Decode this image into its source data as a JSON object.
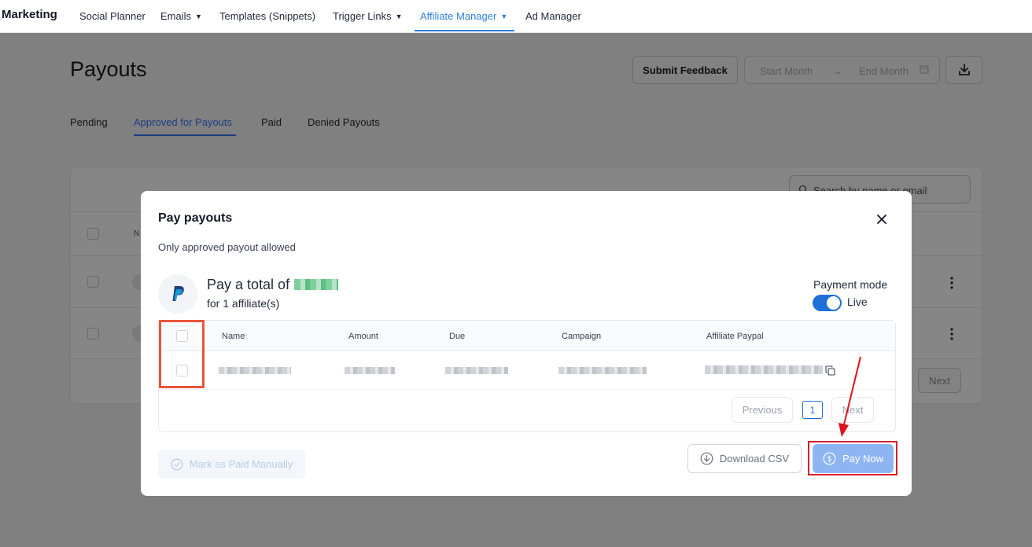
{
  "nav": {
    "brand": "Marketing",
    "items": [
      {
        "label": "Social Planner"
      },
      {
        "label": "Emails"
      },
      {
        "label": "Templates (Snippets)"
      },
      {
        "label": "Trigger Links"
      },
      {
        "label": "Affiliate Manager"
      },
      {
        "label": "Ad Manager"
      }
    ]
  },
  "page": {
    "title": "Payouts",
    "feedback_label": "Submit Feedback",
    "start_month_placeholder": "Start Month",
    "end_month_placeholder": "End Month",
    "tabs": [
      {
        "label": "Pending"
      },
      {
        "label": "Approved for Payouts"
      },
      {
        "label": "Paid"
      },
      {
        "label": "Denied Payouts"
      }
    ],
    "search_placeholder": "Search by name or email",
    "column_initial": "N",
    "next_label": "Next"
  },
  "modal": {
    "title": "Pay payouts",
    "subtitle": "Only approved payout allowed",
    "pay_total_prefix": "Pay a total of",
    "for_affiliates": "for 1 affiliate(s)",
    "payment_mode_label": "Payment mode",
    "payment_mode_value": "Live",
    "columns": [
      "Name",
      "Amount",
      "Due",
      "Campaign",
      "Affiliate Paypal"
    ],
    "previous_label": "Previous",
    "page_number": "1",
    "next_label": "Next",
    "mark_paid_label": "Mark as Paid Manually",
    "download_csv_label": "Download CSV",
    "pay_now_label": "Pay Now"
  },
  "colors": {
    "accent": "#2f80d8",
    "toggle_on": "#1e6fd8",
    "pay_button": "#8eb5f2",
    "highlight_orange": "#e8553a",
    "highlight_red": "#d8202a"
  }
}
